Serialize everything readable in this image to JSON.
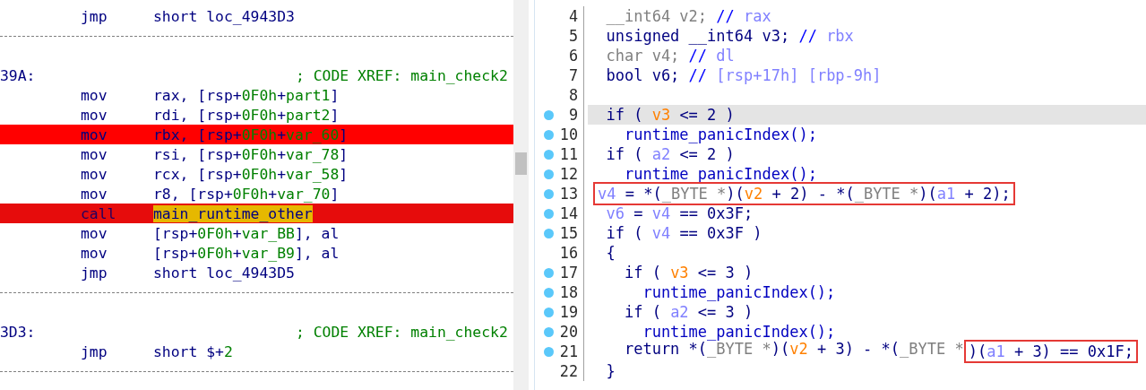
{
  "disassembly": {
    "lines": [
      {
        "kind": "instr",
        "breakpoint": false,
        "current": false,
        "mnemonic": "jmp",
        "operands": [
          {
            "text": "short loc_4943D3",
            "kind": "reg"
          }
        ]
      },
      {
        "kind": "separator"
      },
      {
        "kind": "blank"
      },
      {
        "kind": "label",
        "label": "39A:",
        "comment": "; CODE XREF: main_check2"
      },
      {
        "kind": "instr",
        "breakpoint": false,
        "current": false,
        "mnemonic": "mov",
        "operands": [
          {
            "text": "rax, [rsp+",
            "kind": "reg"
          },
          {
            "text": "0F0h",
            "kind": "num"
          },
          {
            "text": "+",
            "kind": "reg"
          },
          {
            "text": "part1",
            "kind": "name"
          },
          {
            "text": "]",
            "kind": "reg"
          }
        ]
      },
      {
        "kind": "instr",
        "breakpoint": false,
        "current": false,
        "mnemonic": "mov",
        "operands": [
          {
            "text": "rdi, [rsp+",
            "kind": "reg"
          },
          {
            "text": "0F0h",
            "kind": "num"
          },
          {
            "text": "+",
            "kind": "reg"
          },
          {
            "text": "part2",
            "kind": "name"
          },
          {
            "text": "]",
            "kind": "reg"
          }
        ]
      },
      {
        "kind": "instr",
        "breakpoint": true,
        "current": false,
        "mnemonic": "mov",
        "operands": [
          {
            "text": "rbx, [rsp+",
            "kind": "reg"
          },
          {
            "text": "0F0h",
            "kind": "num"
          },
          {
            "text": "+",
            "kind": "reg"
          },
          {
            "text": "var_60",
            "kind": "name"
          },
          {
            "text": "]",
            "kind": "reg"
          }
        ]
      },
      {
        "kind": "instr",
        "breakpoint": false,
        "current": false,
        "mnemonic": "mov",
        "operands": [
          {
            "text": "rsi, [rsp+",
            "kind": "reg"
          },
          {
            "text": "0F0h",
            "kind": "num"
          },
          {
            "text": "+",
            "kind": "reg"
          },
          {
            "text": "var_78",
            "kind": "name"
          },
          {
            "text": "]",
            "kind": "reg"
          }
        ]
      },
      {
        "kind": "instr",
        "breakpoint": false,
        "current": false,
        "mnemonic": "mov",
        "operands": [
          {
            "text": "rcx, [rsp+",
            "kind": "reg"
          },
          {
            "text": "0F0h",
            "kind": "num"
          },
          {
            "text": "+",
            "kind": "reg"
          },
          {
            "text": "var_58",
            "kind": "name"
          },
          {
            "text": "]",
            "kind": "reg"
          }
        ]
      },
      {
        "kind": "instr",
        "breakpoint": false,
        "current": false,
        "mnemonic": "mov",
        "operands": [
          {
            "text": "r8, [rsp+",
            "kind": "reg"
          },
          {
            "text": "0F0h",
            "kind": "num"
          },
          {
            "text": "+",
            "kind": "reg"
          },
          {
            "text": "var_70",
            "kind": "name"
          },
          {
            "text": "]",
            "kind": "reg"
          }
        ]
      },
      {
        "kind": "instr",
        "breakpoint": true,
        "current": true,
        "mnemonic": "call",
        "operands": [
          {
            "text": "main_runtime_other",
            "kind": "reg",
            "selected": true
          }
        ]
      },
      {
        "kind": "instr",
        "breakpoint": false,
        "current": false,
        "mnemonic": "mov",
        "operands": [
          {
            "text": "[rsp+",
            "kind": "reg"
          },
          {
            "text": "0F0h",
            "kind": "num"
          },
          {
            "text": "+",
            "kind": "reg"
          },
          {
            "text": "var_BB",
            "kind": "name"
          },
          {
            "text": "], al",
            "kind": "reg"
          }
        ]
      },
      {
        "kind": "instr",
        "breakpoint": false,
        "current": false,
        "mnemonic": "mov",
        "operands": [
          {
            "text": "[rsp+",
            "kind": "reg"
          },
          {
            "text": "0F0h",
            "kind": "num"
          },
          {
            "text": "+",
            "kind": "reg"
          },
          {
            "text": "var_B9",
            "kind": "name"
          },
          {
            "text": "], al",
            "kind": "reg"
          }
        ]
      },
      {
        "kind": "instr",
        "breakpoint": false,
        "current": false,
        "mnemonic": "jmp",
        "operands": [
          {
            "text": "short loc_4943D5",
            "kind": "reg"
          }
        ]
      },
      {
        "kind": "separator"
      },
      {
        "kind": "blank"
      },
      {
        "kind": "label",
        "label": "3D3:",
        "comment": "; CODE XREF: main_check2"
      },
      {
        "kind": "instr",
        "breakpoint": false,
        "current": false,
        "mnemonic": "jmp",
        "operands": [
          {
            "text": "short $+",
            "kind": "reg"
          },
          {
            "text": "2",
            "kind": "num"
          }
        ]
      },
      {
        "kind": "separator"
      }
    ]
  },
  "pseudocode": {
    "lines": [
      {
        "number": "4",
        "dot": false,
        "highlighted": false,
        "tokens": [
          {
            "text": "  __int64 v2; ",
            "kind": "type"
          },
          {
            "text": "// ",
            "kind": "slash"
          },
          {
            "text": "rax",
            "kind": "arg"
          }
        ]
      },
      {
        "number": "5",
        "dot": false,
        "highlighted": false,
        "tokens": [
          {
            "text": "  unsigned __int64 v3; ",
            "kind": "plain"
          },
          {
            "text": "// ",
            "kind": "slash"
          },
          {
            "text": "rbx",
            "kind": "arg"
          }
        ]
      },
      {
        "number": "6",
        "dot": false,
        "highlighted": false,
        "tokens": [
          {
            "text": "  char v4; ",
            "kind": "type"
          },
          {
            "text": "// ",
            "kind": "slash"
          },
          {
            "text": "dl",
            "kind": "arg"
          }
        ]
      },
      {
        "number": "7",
        "dot": false,
        "highlighted": false,
        "tokens": [
          {
            "text": "  bool v6; ",
            "kind": "plain"
          },
          {
            "text": "// ",
            "kind": "slash"
          },
          {
            "text": "[rsp+17h] [rbp-9h]",
            "kind": "arg"
          }
        ]
      },
      {
        "number": "8",
        "dot": false,
        "highlighted": false
      },
      {
        "number": "9",
        "dot": true,
        "highlighted": true,
        "tokens": [
          {
            "text": "  if ( ",
            "kind": "plain"
          },
          {
            "text": "v3",
            "kind": "var"
          },
          {
            "text": " <= 2 )",
            "kind": "plain"
          }
        ]
      },
      {
        "number": "10",
        "dot": true,
        "highlighted": false,
        "tokens": [
          {
            "text": "    runtime_panicIndex();",
            "kind": "func"
          }
        ]
      },
      {
        "number": "11",
        "dot": true,
        "highlighted": false,
        "tokens": [
          {
            "text": "  if ( ",
            "kind": "plain"
          },
          {
            "text": "a2",
            "kind": "arg"
          },
          {
            "text": " <= 2 )",
            "kind": "plain"
          }
        ]
      },
      {
        "number": "12",
        "dot": true,
        "highlighted": false,
        "tokens": [
          {
            "text": "    runtime_panicIndex();",
            "kind": "func"
          }
        ]
      },
      {
        "number": "13",
        "dot": true,
        "highlighted": false,
        "box": {
          "tokens": [
            {
              "text": "v4",
              "kind": "arg"
            },
            {
              "text": " = *(",
              "kind": "plain"
            },
            {
              "text": "_BYTE *",
              "kind": "type"
            },
            {
              "text": ")(",
              "kind": "plain"
            },
            {
              "text": "v2",
              "kind": "var"
            },
            {
              "text": " + 2) - *(",
              "kind": "plain"
            },
            {
              "text": "_BYTE *",
              "kind": "type"
            },
            {
              "text": ")(",
              "kind": "plain"
            },
            {
              "text": "a1",
              "kind": "arg"
            },
            {
              "text": " + 2);",
              "kind": "plain"
            }
          ]
        }
      },
      {
        "number": "14",
        "dot": true,
        "highlighted": false,
        "tokens": [
          {
            "text": "  v6",
            "kind": "arg"
          },
          {
            "text": " = ",
            "kind": "plain"
          },
          {
            "text": "v4",
            "kind": "arg"
          },
          {
            "text": " == 0x3F;",
            "kind": "plain"
          }
        ]
      },
      {
        "number": "15",
        "dot": true,
        "highlighted": false,
        "tokens": [
          {
            "text": "  if ( ",
            "kind": "plain"
          },
          {
            "text": "v4",
            "kind": "arg"
          },
          {
            "text": " == 0x3F )",
            "kind": "plain"
          }
        ]
      },
      {
        "number": "16",
        "dot": false,
        "highlighted": false,
        "tokens": [
          {
            "text": "  {",
            "kind": "plain"
          }
        ]
      },
      {
        "number": "17",
        "dot": true,
        "highlighted": false,
        "tokens": [
          {
            "text": "    if ( ",
            "kind": "plain"
          },
          {
            "text": "v3",
            "kind": "var"
          },
          {
            "text": " <= 3 )",
            "kind": "plain"
          }
        ]
      },
      {
        "number": "18",
        "dot": true,
        "highlighted": false,
        "tokens": [
          {
            "text": "      runtime_panicIndex();",
            "kind": "func"
          }
        ]
      },
      {
        "number": "19",
        "dot": true,
        "highlighted": false,
        "tokens": [
          {
            "text": "    if ( ",
            "kind": "plain"
          },
          {
            "text": "a2",
            "kind": "arg"
          },
          {
            "text": " <= 3 )",
            "kind": "plain"
          }
        ]
      },
      {
        "number": "20",
        "dot": true,
        "highlighted": false,
        "tokens": [
          {
            "text": "      runtime_panicIndex();",
            "kind": "func"
          }
        ]
      },
      {
        "number": "21",
        "dot": true,
        "highlighted": false,
        "tokens": [
          {
            "text": "    return *(",
            "kind": "plain"
          },
          {
            "text": "_BYTE *",
            "kind": "type"
          },
          {
            "text": ")(",
            "kind": "plain"
          },
          {
            "text": "v2",
            "kind": "var"
          },
          {
            "text": " + 3) - *(",
            "kind": "plain"
          },
          {
            "text": "_BYTE *",
            "kind": "type"
          }
        ],
        "box": {
          "tokens": [
            {
              "text": ")(",
              "kind": "plain"
            },
            {
              "text": "a1",
              "kind": "arg"
            },
            {
              "text": " + 3) == 0x1F;",
              "kind": "plain"
            }
          ]
        }
      },
      {
        "number": "22",
        "dot": false,
        "highlighted": false,
        "tokens": [
          {
            "text": "  }",
            "kind": "plain"
          }
        ]
      }
    ]
  }
}
